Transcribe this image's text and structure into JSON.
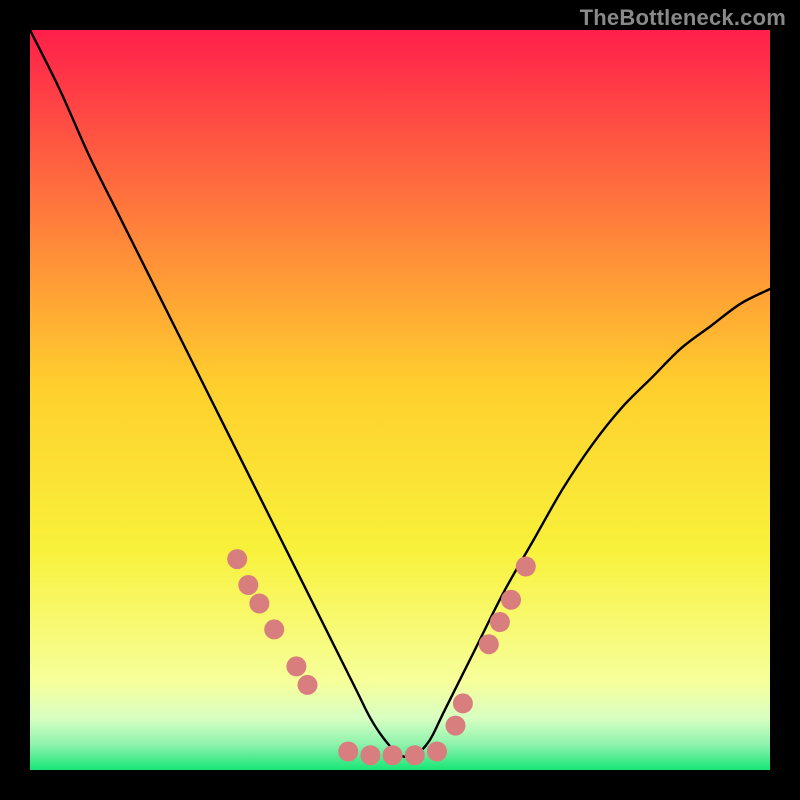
{
  "watermark": "TheBottleneck.com",
  "chart_data": {
    "type": "line",
    "title": "",
    "xlabel": "",
    "ylabel": "",
    "xlim": [
      0,
      100
    ],
    "ylim": [
      0,
      100
    ],
    "legend": false,
    "grid": false,
    "background_gradient": {
      "top_color": "#ff1f4b",
      "mid_color": "#ffe63a",
      "bottom_color": "#17e676"
    },
    "series": [
      {
        "name": "bottleneck-curve",
        "x": [
          0,
          4,
          8,
          12,
          16,
          20,
          24,
          28,
          32,
          36,
          40,
          44,
          46,
          48,
          50,
          52,
          54,
          56,
          60,
          64,
          68,
          72,
          76,
          80,
          84,
          88,
          92,
          96,
          100
        ],
        "y": [
          100,
          92,
          83,
          75,
          67,
          59,
          51,
          43,
          35,
          27,
          19,
          11,
          7,
          4,
          2,
          2,
          4,
          8,
          16,
          24,
          31,
          38,
          44,
          49,
          53,
          57,
          60,
          63,
          65
        ]
      }
    ],
    "markers": [
      {
        "x": 28.0,
        "y": 28.5
      },
      {
        "x": 29.5,
        "y": 25.0
      },
      {
        "x": 31.0,
        "y": 22.5
      },
      {
        "x": 33.0,
        "y": 19.0
      },
      {
        "x": 36.0,
        "y": 14.0
      },
      {
        "x": 37.5,
        "y": 11.5
      },
      {
        "x": 43.0,
        "y": 2.5
      },
      {
        "x": 46.0,
        "y": 2.0
      },
      {
        "x": 49.0,
        "y": 2.0
      },
      {
        "x": 52.0,
        "y": 2.0
      },
      {
        "x": 55.0,
        "y": 2.5
      },
      {
        "x": 57.5,
        "y": 6.0
      },
      {
        "x": 58.5,
        "y": 9.0
      },
      {
        "x": 62.0,
        "y": 17.0
      },
      {
        "x": 63.5,
        "y": 20.0
      },
      {
        "x": 65.0,
        "y": 23.0
      },
      {
        "x": 67.0,
        "y": 27.5
      }
    ],
    "marker_color": "#d97e7e",
    "marker_radius": 10
  }
}
